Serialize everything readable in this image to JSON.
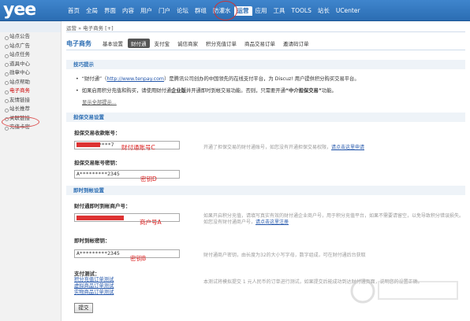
{
  "header": {
    "logo": "yee",
    "nav": [
      "首页",
      "全局",
      "界面",
      "内容",
      "用户",
      "门户",
      "论坛",
      "群组",
      "防灌水",
      "运营",
      "应用",
      "工具",
      "TOOLS",
      "站长",
      "UCenter"
    ],
    "active_nav_index": 9
  },
  "sidebar": {
    "items": [
      "站点公告",
      "站点广告",
      "站点任务",
      "道具中心",
      "勋章中心",
      "站点帮助",
      "电子商务",
      "友情链接",
      "站长推荐",
      "关联链接",
      "充值卡密"
    ],
    "active_index": 6
  },
  "breadcrumb": "运营 » 电子商务  [+]",
  "tabs": {
    "title": "电子商务",
    "items": [
      "基本设置",
      "财付通",
      "支付宝",
      "诚信商家",
      "积分充值订单",
      "商品交易订单",
      "邀请码订单"
    ],
    "active_index": 1
  },
  "tips": {
    "heading": "技巧提示",
    "line1_pre": "“财付通”（",
    "line1_link": "http://www.tenpay.com",
    "line1_post": "）是腾讯公司创办的中国领先的在线支付平台，为 Discuz! 用户提供积分购买交易平台。",
    "line2_pre": "如果启用积分充值和购买，请使用财付通",
    "line2_bold1": "企业版",
    "line2_mid": "并开通即时到帐交易功能。否则，只需要开通",
    "line2_bold2": "中介担保交易",
    "line2_post": "功能。",
    "more": "显示全部提示..."
  },
  "escrow": {
    "heading": "担保交易设置",
    "account_label": "担保交易收款账号：",
    "account_value": "****7",
    "account_annotation": "财付通账号C",
    "account_help": "开通了担保交易的财付通账号，如您没有开通担保交易权限，",
    "account_help_link": "请点击这里申请",
    "key_label": "担保交易账号密钥：",
    "key_value": "A*********2345",
    "key_annotation": "密钥D"
  },
  "instant": {
    "heading": "即时到帐设置",
    "merchant_label": "财付通即时到帐商户号：",
    "merchant_value": "",
    "merchant_annotation": "商户号A",
    "merchant_help1": "如果开启积分充值，请填写真实有效的财付通企业商户号，用于积分充值平台，如果不需要请留空，以免导致积分错误损失。",
    "merchant_help2": "如您没有财付通商户号，",
    "merchant_help_link": "请点击这里注册",
    "key_label": "即时到帐密钥：",
    "key_value": "A*********2345",
    "key_annotation": "密钥B",
    "key_help": "财付通商户密钥，由长度为32的大小写字母，数字组成，可在财付通后台获取"
  },
  "payment_test": {
    "heading": "支付测试：",
    "links": [
      "积分充值订单测试",
      "虚拟商品订单测试",
      "实物商品订单测试"
    ],
    "help": "本测试将模拟提交 1 元人民币的订单进行测试，如果提交后能成功到达财付通页面，说明您的设置正确。"
  },
  "submit_label": "提交",
  "colors": {
    "topbar": "#2b6db3",
    "annotation_red": "#dd2222",
    "link_blue": "#2255aa"
  }
}
